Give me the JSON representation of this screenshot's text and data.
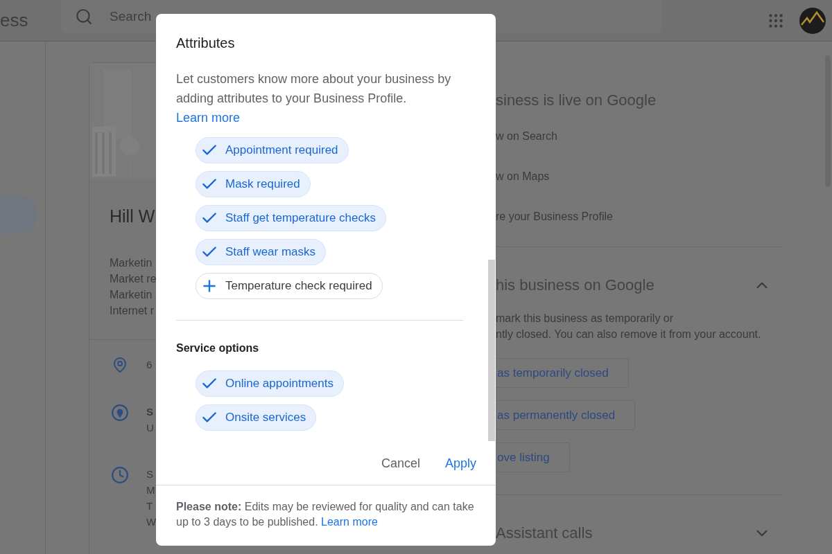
{
  "header": {
    "brand": "ess",
    "search": {
      "placeholder": "Search"
    }
  },
  "card": {
    "name": "Hill W",
    "categories": [
      "Marketin",
      "Market re",
      "Marketin",
      "Internet r"
    ],
    "info_rows": [
      {
        "kind": "address",
        "lines": [
          {
            "text": "6",
            "bold": false
          }
        ]
      },
      {
        "kind": "service_area",
        "lines": [
          {
            "text": "S",
            "bold": true
          },
          {
            "text": "U",
            "bold": false
          }
        ]
      },
      {
        "kind": "hours",
        "lines": [
          {
            "text": "S",
            "bold": false
          },
          {
            "text": "M",
            "bold": false
          },
          {
            "text": "T",
            "bold": false
          },
          {
            "text": "W",
            "bold": false
          }
        ]
      }
    ]
  },
  "right_panel": {
    "live_heading": "siness is live on Google",
    "links": [
      "w on Search",
      "w on Maps",
      "re your Business Profile"
    ],
    "sections": [
      {
        "title": "his business on Google",
        "expanded": true,
        "description": "mark this business as temporarily or\nntly closed. You can also remove it from your account.",
        "buttons": [
          "as temporarily closed",
          "as permanently closed",
          "ove listing"
        ]
      },
      {
        "title": "Assistant calls",
        "expanded": false
      }
    ]
  },
  "dialog": {
    "title": "Attributes",
    "description": "Let customers know more about your business by adding attributes to your Business Profile.",
    "learn_more": "Learn more",
    "groups": [
      {
        "items": [
          {
            "label": "Appointment required",
            "selected": true
          },
          {
            "label": "Mask required",
            "selected": true
          },
          {
            "label": "Staff get temperature checks",
            "selected": true
          },
          {
            "label": "Staff wear masks",
            "selected": true
          },
          {
            "label": "Temperature check required",
            "selected": false
          }
        ]
      },
      {
        "title": "Service options",
        "items": [
          {
            "label": "Online appointments",
            "selected": true
          },
          {
            "label": "Onsite services",
            "selected": true
          }
        ]
      }
    ],
    "actions": [
      "Cancel",
      "Apply"
    ],
    "note": "**Please note:** Edits may be reviewed for quality and can take up to 3 days to be published.",
    "note_link": "Learn more"
  }
}
